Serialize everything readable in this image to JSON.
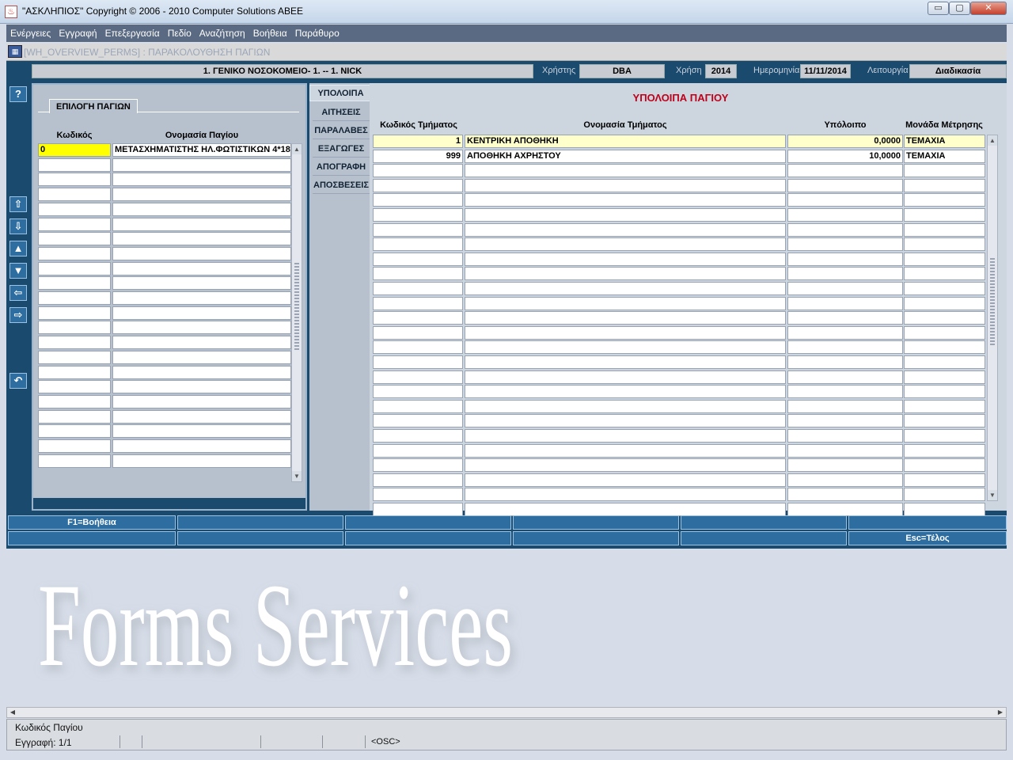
{
  "window": {
    "title": "\"ΑΣΚΛΗΠΙΟΣ\" Copyright © 2006 - 2010 Computer Solutions ABEE",
    "minimize": "▭",
    "maximize": "▢",
    "close": "✕"
  },
  "menu": [
    "Ενέργειες",
    "Εγγραφή",
    "Επεξεργασία",
    "Πεδίο",
    "Αναζήτηση",
    "Βοήθεια",
    "Παράθυρο"
  ],
  "form": {
    "title": "[WH_OVERVIEW_PERMS]   :   ΠΑΡΑΚΟΛΟΥΘΗΣΗ ΠΑΓΙΩΝ"
  },
  "header": {
    "organization": "1. ΓΕΝΙΚΟ ΝΟΣΟΚΟΜΕΙΟ- 1. -- 1. NICK",
    "user_label": "Χρήστης",
    "user_value": "DBA",
    "year_label": "Χρήση",
    "year_value": "2014",
    "date_label": "Ημερομηνία",
    "date_value": "11/11/2014",
    "mode_label": "Λειτουργία",
    "mode_value": "Διαδικασία"
  },
  "toolbar": {
    "help": "?",
    "first": "⇧",
    "last": "⇩",
    "prev": "▲",
    "next": "▼",
    "back": "⇦",
    "forward": "⇨",
    "undo": "↶"
  },
  "left_panel": {
    "title": "ΕΠΙΛΟΓΗ ΠΑΓΙΩΝ",
    "col_code": "Κωδικός",
    "col_name": "Ονομασία Παγίου",
    "rows": [
      {
        "code": "0",
        "name": "ΜΕΤΑΣΧΗΜΑΤΙΣΤΗΣ ΗΛ.ΦΩΤΙΣΤΙΚΩΝ 4*18"
      }
    ],
    "empty_rows": 21
  },
  "tabs": [
    "ΥΠΟΛΟΙΠΑ",
    "ΑΙΤΗΣΕΙΣ",
    "ΠΑΡΑΛΑΒΕΣ",
    "ΕΞΑΓΩΓΕΣ",
    "ΑΠΟΓΡΑΦΗ",
    "ΑΠΟΣΒΕΣΕΙΣ"
  ],
  "right_panel": {
    "title": "ΥΠΟΛΟΙΠΑ ΠΑΓΙΟΥ",
    "col_dept_code": "Κωδικός Τμήματος",
    "col_dept_name": "Ονομασία Τμήματος",
    "col_balance": "Υπόλοιπο",
    "col_unit": "Μονάδα Μέτρησης",
    "rows": [
      {
        "code": "1",
        "name": "ΚΕΝΤΡΙΚΗ ΑΠΟΘΗΚΗ",
        "balance": "0,0000",
        "unit": "ΤΕΜΑΧΙΑ"
      },
      {
        "code": "999",
        "name": "ΑΠΟΘΗΚΗ ΑΧΡΗΣΤΟΥ",
        "balance": "10,0000",
        "unit": "ΤΕΜΑΧΙΑ"
      }
    ],
    "empty_rows": 24
  },
  "function_keys": {
    "row1": [
      "F1=Βοήθεια",
      "",
      "",
      "",
      "",
      ""
    ],
    "row2": [
      "",
      "",
      "",
      "",
      "",
      "Esc=Τέλος"
    ]
  },
  "watermark": "Forms Services",
  "status": {
    "hint": "Κωδικός Παγίου",
    "record": "Εγγραφή: 1/1",
    "osc": "<OSC>"
  },
  "colors": {
    "canvas": "#1a4a6e",
    "selected_cell": "#ffff00",
    "current_row": "#ffffcc",
    "panel_title_red": "#c0001a",
    "button_blue": "#2d6da0"
  }
}
